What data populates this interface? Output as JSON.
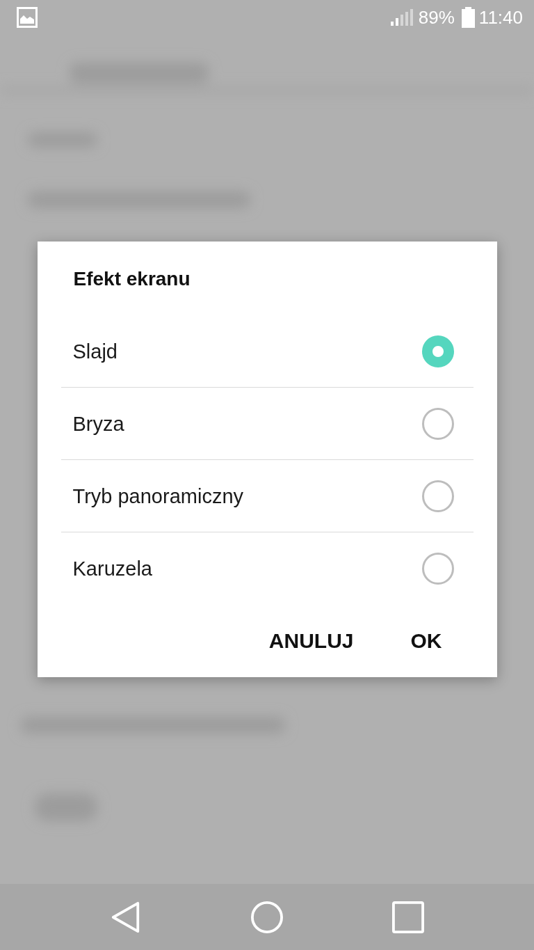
{
  "status_bar": {
    "battery": "89%",
    "time": "11:40"
  },
  "dialog": {
    "title": "Efekt ekranu",
    "options": [
      {
        "label": "Slajd",
        "selected": true
      },
      {
        "label": "Bryza",
        "selected": false
      },
      {
        "label": "Tryb panoramiczny",
        "selected": false
      },
      {
        "label": "Karuzela",
        "selected": false
      }
    ],
    "buttons": [
      "ANULUJ",
      "OK"
    ]
  }
}
